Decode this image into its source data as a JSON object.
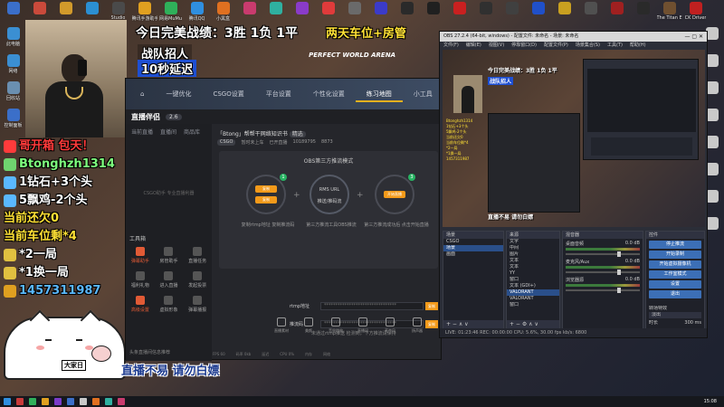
{
  "desktop_top_icons": [
    {
      "label": "",
      "color": "#3b6fc9"
    },
    {
      "label": "",
      "color": "#c94a3b"
    },
    {
      "label": "",
      "color": "#d29a2b"
    },
    {
      "label": "",
      "color": "#2b8fd2"
    },
    {
      "label": "Studio",
      "color": "#4a4a4a"
    },
    {
      "label": "腾讯手游助手",
      "color": "#e0a020"
    },
    {
      "label": "网易MuMu",
      "color": "#2fb05a"
    },
    {
      "label": "腾讯QQ",
      "color": "#2f8fe0"
    },
    {
      "label": "小黑盒",
      "color": "#e07020"
    },
    {
      "label": "",
      "color": "#c93b6e"
    },
    {
      "label": "",
      "color": "#2fb0a0"
    },
    {
      "label": "",
      "color": "#8a3bc9"
    },
    {
      "label": "",
      "color": "#e03b3b"
    },
    {
      "label": "",
      "color": "#6a6a6a"
    },
    {
      "label": "",
      "color": "#3b3bc9"
    },
    {
      "label": "",
      "color": "#2a2a2a"
    },
    {
      "label": "",
      "color": "#202020"
    },
    {
      "label": "",
      "color": "#c92020"
    },
    {
      "label": "",
      "color": "#303030"
    },
    {
      "label": "",
      "color": "#404040"
    },
    {
      "label": "",
      "color": "#2050c9"
    },
    {
      "label": "",
      "color": "#c9a020"
    },
    {
      "label": "",
      "color": "#505050"
    },
    {
      "label": "",
      "color": "#a02020"
    },
    {
      "label": "",
      "color": "#2a2a2a"
    },
    {
      "label": "The Titan Engineer",
      "color": "#705030"
    },
    {
      "label": "CK Driver",
      "color": "#c02020"
    }
  ],
  "desktop_left_icons": [
    {
      "label": "此电脑",
      "color": "#3b8fd2"
    },
    {
      "label": "网络",
      "color": "#3b8fd2"
    },
    {
      "label": "回收站",
      "color": "#6a8fb0"
    },
    {
      "label": "控制面板",
      "color": "#3b6fc9"
    }
  ],
  "desktop_right_icons": [
    {
      "label": "",
      "color": "#c9c9c9"
    },
    {
      "label": "",
      "color": "#c9c9c9"
    },
    {
      "label": "",
      "color": "#c9c9c9"
    },
    {
      "label": "",
      "color": "#c9c9c9"
    },
    {
      "label": "",
      "color": "#c9c9c9"
    },
    {
      "label": "",
      "color": "#c9c9c9"
    },
    {
      "label": "",
      "color": "#c9c9c9"
    },
    {
      "label": "",
      "color": "#c9c9c9"
    }
  ],
  "overlay": {
    "title": "今日完美战绩：3胜 1负 1平",
    "badge": "两天车位+房管",
    "sub1": "战队招人",
    "sub2": "10秒延迟",
    "lines": [
      {
        "text": "哥开箱     包天！",
        "color": "#ff3b3b",
        "icon_color": "#ff3b3b"
      },
      {
        "text": "Btonghzh1314",
        "color": "#7dff7d",
        "icon_color": "#6fd46f"
      },
      {
        "text": "1钻石+3个头",
        "color": "#ffffff",
        "icon_color": "#5ab8ff"
      },
      {
        "text": "5飘鸡-2个头",
        "color": "#ffffff",
        "icon_color": "#5ab8ff"
      },
      {
        "text": "当前还欠0",
        "color": "#ffe135",
        "icon_color": ""
      },
      {
        "text": "当前车位剩*4",
        "color": "#ffe135",
        "icon_color": ""
      },
      {
        "text": "*2一局",
        "color": "#ffffff",
        "icon_color": "#e0c040"
      },
      {
        "text": "*1换一局",
        "color": "#ffffff",
        "icon_color": "#e0c040"
      },
      {
        "text": "1457311987",
        "color": "#5ab8ff",
        "icon_color": "#e0a020"
      }
    ],
    "bottom": "直播不易 请勿白嫖",
    "cat_tag": "大家日"
  },
  "csgo": {
    "arena": "PERFECT WORLD ARENA",
    "nav": [
      "一键优化",
      "CSGO设置",
      "平台设置",
      "个性化设置",
      "练习地图",
      "小工具"
    ],
    "active_nav": 4,
    "logo": "直播伴侣",
    "version": "2.6",
    "side_tabs": [
      "当前直播",
      "直播间",
      "商品库"
    ],
    "side_hint": "CSGO助手 专业直播利器",
    "room_title": "「Btong」帮帮干网络知识书",
    "room_pill": "精选",
    "room_meta": [
      "CSGO",
      "暂时未上车",
      "已开直播",
      "10189795",
      "8873"
    ],
    "obs_title": "OBS第三方推流模式",
    "circle1": {
      "num": "1",
      "b1": "复制",
      "b2": "复制",
      "lbl": "复制rtmp地址 复制推流码"
    },
    "circle2": {
      "cap1": "RMS URL",
      "cap2": "推送/推码流",
      "lbl": "第三方推流工具OBS推流"
    },
    "circle3": {
      "num": "3",
      "b1": "开始直播",
      "lbl": "第三方推流成功后 点击开始直播"
    },
    "rtmp_label": "rtmp地址",
    "rtmp_value": "********************************",
    "key_label": "推流码",
    "key_value": "********************************",
    "copy": "复制",
    "warn": "未通过rtmp推送 检测到，下方推流请保持",
    "toolbox_title": "工具箱",
    "tools": [
      {
        "label": "弹幕助手",
        "hot": true
      },
      {
        "label": "房管助手",
        "hot": false
      },
      {
        "label": "直播任务",
        "hot": false
      },
      {
        "label": "福利礼物",
        "hot": false
      },
      {
        "label": "进入直播",
        "hot": false
      },
      {
        "label": "发起投票",
        "hot": false
      },
      {
        "label": "高级设置",
        "hot": true
      },
      {
        "label": "虚拟形象",
        "hot": false
      },
      {
        "label": "弹幕播报",
        "hot": false
      }
    ],
    "side_foot": "头条直播间信息推荐",
    "bottom_tools": [
      "直播素材",
      "美颜",
      "音效特效",
      "直播间",
      "麦克风",
      "扬声器"
    ],
    "status": [
      "FPS 60",
      "码率 0kb",
      "延迟",
      "CPU 0%",
      "内存",
      "网络"
    ]
  },
  "obs": {
    "title": "OBS 27.2.4 (64-bit, windows) - 配置文件: 未命名 - 场景: 未命名",
    "menu": [
      "文件(F)",
      "编辑(E)",
      "视图(V)",
      "停靠窗口(D)",
      "配置文件(P)",
      "场景集合(S)",
      "工具(T)",
      "帮助(H)"
    ],
    "preview_title": "今日完美战绩：3胜 1负 1平",
    "preview_sub": "战队招人",
    "preview_chat": [
      "Btonghzh1314",
      "1钻石+3个头",
      "5飘鸡-2个头",
      "当前还欠0",
      "当前车位剩*4",
      "*2一局",
      "*1换一局",
      "1457311987"
    ],
    "preview_footer": "直播不易 请勿白嫖",
    "scenes_header": "场景",
    "scenes": [
      "CSGO"
    ],
    "scene_items": [
      "场景",
      "画面"
    ],
    "sources_header": "来源",
    "sources": [
      "文字",
      "中间",
      "图片",
      "文本",
      "文本",
      "YY",
      "窗口",
      "文本 (GDI+)",
      "VALORANT",
      "VALORANT",
      "窗口"
    ],
    "mixer_header": "混音器",
    "tracks": [
      {
        "name": "桌面音频",
        "db": "0.0 dB"
      },
      {
        "name": "麦克风/Aux",
        "db": "0.0 dB"
      },
      {
        "name": "浏览器源",
        "db": "0.0 dB"
      }
    ],
    "controls_header": "控件",
    "controls": [
      "停止推流",
      "开始录制",
      "开始虚拟摄像机",
      "工作室模式",
      "设置",
      "退出"
    ],
    "transition_label": "转场特效",
    "transition_value": "淡出",
    "duration_label": "时长",
    "duration_value": "300 ms",
    "source_bar": "{sgo.exe}: Counter-Strike: Global Of",
    "status": "LIVE: 01:23:46   REC: 00:00:00   CPU: 5.6%, 30.00 fps   kb/s: 6800"
  },
  "taskbar": {
    "icons": [
      "#2f8fe0",
      "#c93b3b",
      "#2fb05a",
      "#e0a020",
      "#7a3bc9",
      "#3b6fc9",
      "#c9c9c9",
      "#e07020",
      "#2fb0a0",
      "#c93b6e"
    ],
    "clock": "15:08"
  }
}
